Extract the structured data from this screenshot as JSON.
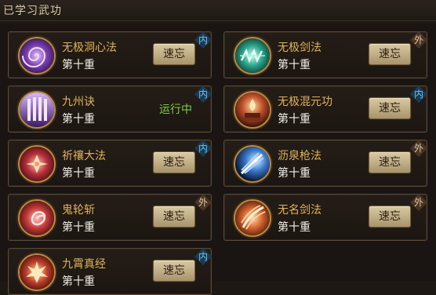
{
  "header": {
    "title": "已学习武功"
  },
  "skills": [
    {
      "name": "无极洞心法",
      "level": "第十重",
      "action": "速忘",
      "badge": "内",
      "badge_type": "inner",
      "icon": "purple-vortex-icon",
      "color": "#7a3fb0"
    },
    {
      "name": "无极剑法",
      "level": "第十重",
      "action": "速忘",
      "badge": "外",
      "badge_type": "outer",
      "icon": "teal-sword-energy-icon",
      "color": "#2aa28a"
    },
    {
      "name": "九州诀",
      "level": "第十重",
      "status": "运行中",
      "badge": "内",
      "badge_type": "inner",
      "icon": "violet-pillars-icon",
      "color": "#6b3fa8"
    },
    {
      "name": "无极混元功",
      "level": "第十重",
      "action": "速忘",
      "badge": "内",
      "badge_type": "inner",
      "icon": "fire-altar-icon",
      "color": "#c0502a"
    },
    {
      "name": "祈禳大法",
      "level": "第十重",
      "action": "速忘",
      "badge": "内",
      "badge_type": "inner",
      "icon": "crimson-lotus-icon",
      "color": "#b5303a"
    },
    {
      "name": "沥泉枪法",
      "level": "第十重",
      "action": "速忘",
      "badge": "外",
      "badge_type": "outer",
      "icon": "blue-spear-strike-icon",
      "color": "#3a78c8"
    },
    {
      "name": "鬼轮斩",
      "level": "第十重",
      "action": "速忘",
      "badge": "外",
      "badge_type": "outer",
      "icon": "red-spiral-wheel-icon",
      "color": "#c43a3a"
    },
    {
      "name": "无名剑法",
      "level": "第十重",
      "action": "速忘",
      "badge": "外",
      "badge_type": "outer",
      "icon": "orange-slash-icon",
      "color": "#d0602a"
    },
    {
      "name": "九霄真经",
      "level": "第十重",
      "action": "速忘",
      "badge": "内",
      "badge_type": "inner",
      "icon": "red-flame-burst-icon",
      "color": "#c0402a"
    }
  ]
}
